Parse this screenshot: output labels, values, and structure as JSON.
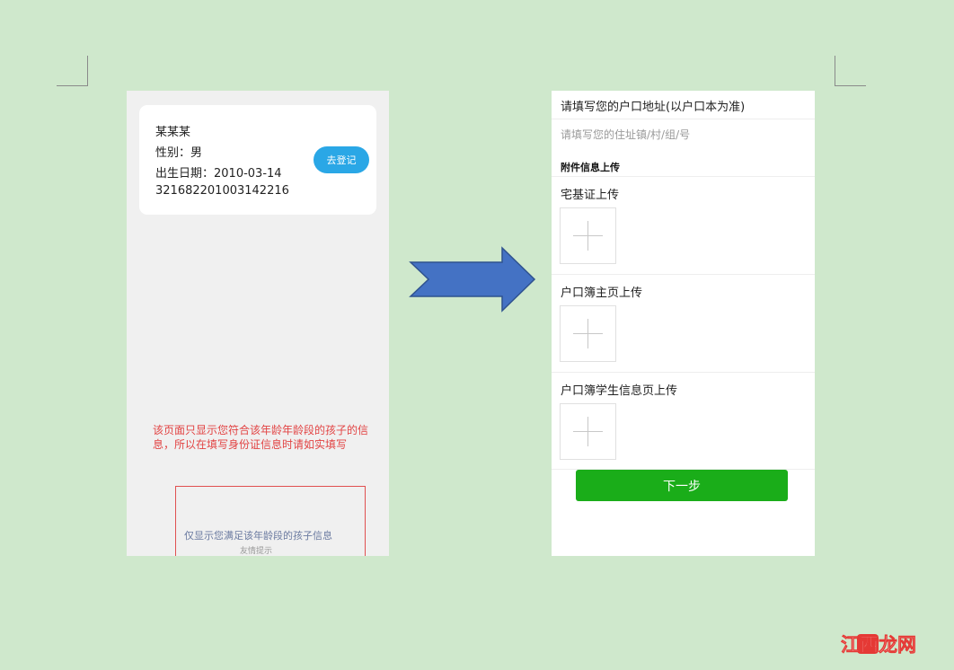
{
  "left_screen": {
    "child": {
      "name": "某某某",
      "gender": "性别：男",
      "birth_date": "出生日期：2010-03-14",
      "id_number": "321682201003142216"
    },
    "register_button": "去登记",
    "notice": "该页面只显示您符合该年龄年龄段的孩子的信息，所以在填写身份证信息时请如实填写",
    "tip_main": "仅显示您满足该年龄段的孩子信息",
    "tip_sub": "友情提示"
  },
  "right_screen": {
    "address_label": "请填写您的户口地址(以户口本为准)",
    "address_placeholder": "请填写您的住址镇/村/组/号",
    "attachment_title": "附件信息上传",
    "uploads": [
      {
        "label": "宅基证上传"
      },
      {
        "label": "户口簿主页上传"
      },
      {
        "label": "户口簿学生信息页上传"
      }
    ],
    "next_button": "下一步"
  },
  "watermark": {
    "text": "江西龙网"
  },
  "colors": {
    "page_bg": "#cfe8cc",
    "register_btn": "#2aa7e6",
    "next_btn": "#1aad19",
    "notice_red": "#e24343",
    "arrow_fill": "#4472c4"
  }
}
